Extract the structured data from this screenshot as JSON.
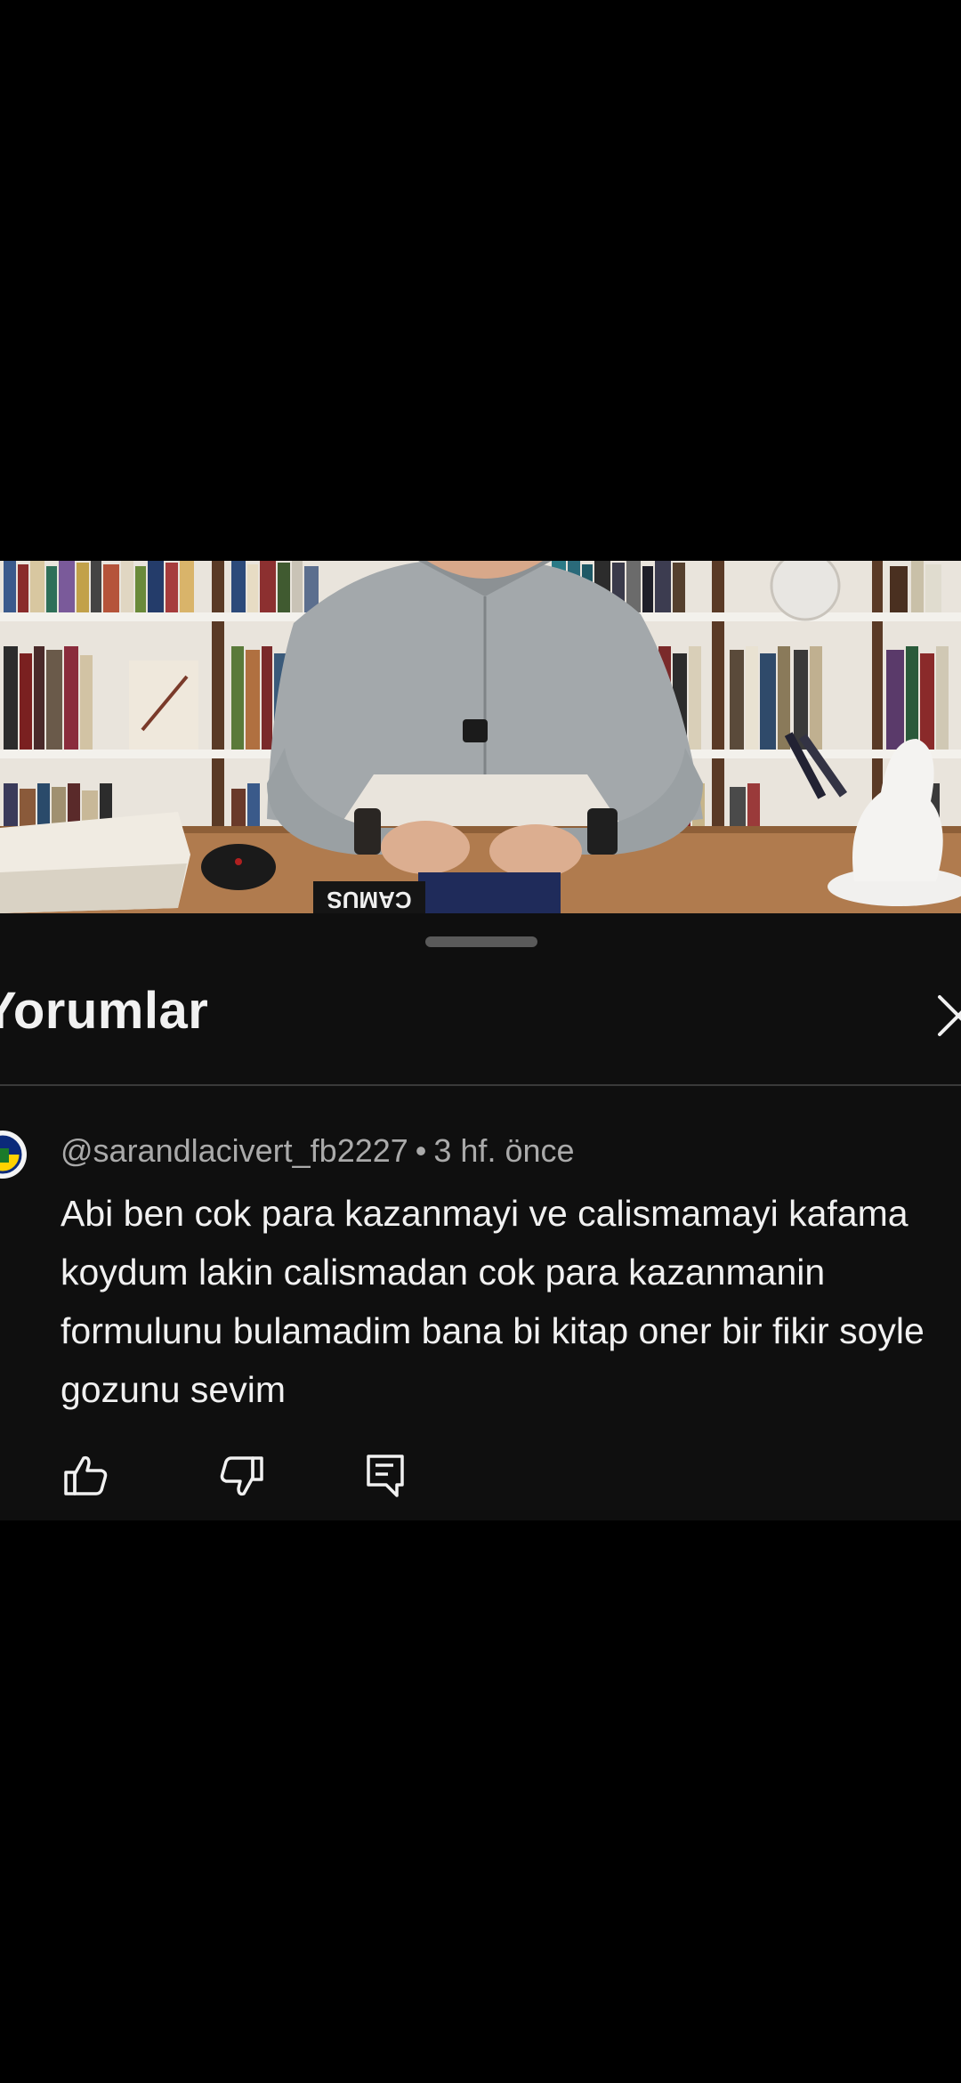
{
  "comments_panel": {
    "title": "Yorumlar",
    "close_icon": "close-icon"
  },
  "comment": {
    "author": "@sarandlacivert_fb2227",
    "separator": "•",
    "time": "3 hf. önce",
    "text": "Abi ben cok para kazanmayi ve calismamayi kafama koydum lakin calismadan cok para kazanmanin formulunu bulamadim bana bi kitap oner bir fikir soyle gozunu sevim",
    "actions": {
      "like_icon": "thumbs-up-icon",
      "dislike_icon": "thumbs-down-icon",
      "reply_icon": "reply-icon"
    }
  },
  "video": {
    "book_spine_text": "CAMUS"
  },
  "colors": {
    "background": "#000000",
    "sheet": "#0f0f0f",
    "primary_text": "#f1f1f1",
    "secondary_text": "#aaaaaa",
    "divider": "#3a3a3a"
  }
}
